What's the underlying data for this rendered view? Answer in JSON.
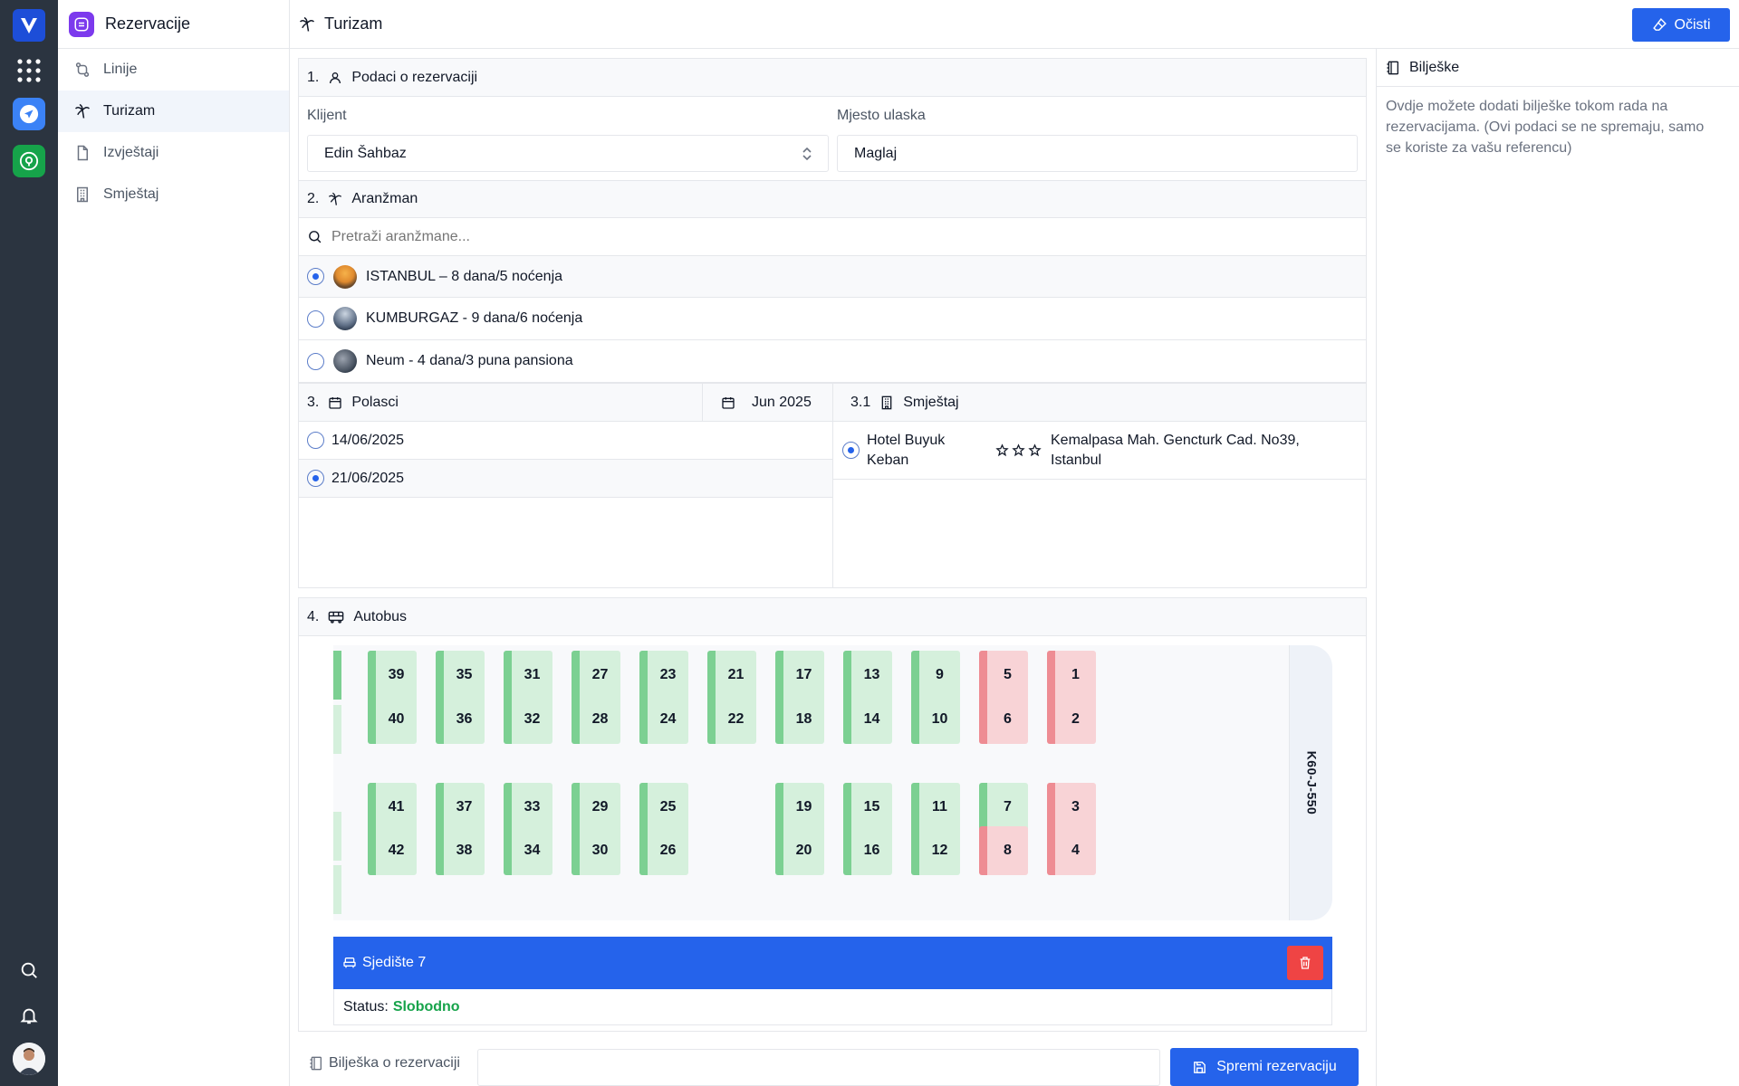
{
  "app": {
    "title": "Rezervacije",
    "page_title": "Turizam",
    "clear_label": "Očisti"
  },
  "sidebar": {
    "items": [
      {
        "label": "Linije",
        "icon": "route-icon"
      },
      {
        "label": "Turizam",
        "icon": "palm-tree-icon",
        "active": true
      },
      {
        "label": "Izvještaji",
        "icon": "document-icon"
      },
      {
        "label": "Smještaj",
        "icon": "building-icon"
      }
    ]
  },
  "reservation": {
    "num": "1.",
    "title": "Podaci o rezervaciji",
    "client_label": "Klijent",
    "client_value": "Edin Šahbaz",
    "boarding_label": "Mjesto ulaska",
    "boarding_value": "Maglaj"
  },
  "arrangement": {
    "num": "2.",
    "title": "Aranžman",
    "search_placeholder": "Pretraži aranžmane...",
    "items": [
      {
        "label": "ISTANBUL – 8 dana/5 noćenja",
        "selected": true
      },
      {
        "label": "KUMBURGAZ - 9 dana/6 noćenja",
        "selected": false
      },
      {
        "label": "Neum - 4 dana/3 puna pansiona",
        "selected": false
      }
    ]
  },
  "departures": {
    "num": "3.",
    "title": "Polasci",
    "month": "Jun 2025",
    "items": [
      {
        "date": "14/06/2025",
        "selected": false
      },
      {
        "date": "21/06/2025",
        "selected": true
      }
    ]
  },
  "accommodation": {
    "num": "3.1",
    "title": "Smještaj",
    "hotel_line1": "Hotel Buyuk",
    "hotel_line2": "Keban",
    "address_line1": "Kemalpasa Mah. Gencturk Cad. No39,",
    "address_line2": "Istanbul",
    "stars": 3
  },
  "bus": {
    "num": "4.",
    "title": "Autobus",
    "plate": "K60-J-550",
    "selected_seat_label": "Sjedište 7",
    "status_label": "Status:",
    "status_value": "Slobodno",
    "colors": {
      "free": "#d5f0dc",
      "free_accent": "#7cd092",
      "taken": "#f8d3d6",
      "taken_accent": "#ee8c93",
      "selected_bar": "#2563eb",
      "status_ok": "#16a34a"
    },
    "seats": [
      {
        "n": "39",
        "s": "free"
      },
      {
        "n": "35",
        "s": "free"
      },
      {
        "n": "31",
        "s": "free"
      },
      {
        "n": "27",
        "s": "free"
      },
      {
        "n": "23",
        "s": "free"
      },
      {
        "n": "21",
        "s": "free"
      },
      {
        "n": "17",
        "s": "free"
      },
      {
        "n": "13",
        "s": "free"
      },
      {
        "n": "9",
        "s": "free"
      },
      {
        "n": "5",
        "s": "taken"
      },
      {
        "n": "1",
        "s": "taken"
      },
      {
        "n": "40",
        "s": "free"
      },
      {
        "n": "36",
        "s": "free"
      },
      {
        "n": "32",
        "s": "free"
      },
      {
        "n": "28",
        "s": "free"
      },
      {
        "n": "24",
        "s": "free"
      },
      {
        "n": "22",
        "s": "free"
      },
      {
        "n": "18",
        "s": "free"
      },
      {
        "n": "14",
        "s": "free"
      },
      {
        "n": "10",
        "s": "free"
      },
      {
        "n": "6",
        "s": "taken"
      },
      {
        "n": "2",
        "s": "taken"
      },
      {
        "n": "41",
        "s": "free"
      },
      {
        "n": "37",
        "s": "free"
      },
      {
        "n": "33",
        "s": "free"
      },
      {
        "n": "29",
        "s": "free"
      },
      {
        "n": "25",
        "s": "free"
      },
      {
        "n": "19",
        "s": "free"
      },
      {
        "n": "15",
        "s": "free"
      },
      {
        "n": "11",
        "s": "free"
      },
      {
        "n": "7",
        "s": "free"
      },
      {
        "n": "3",
        "s": "taken"
      },
      {
        "n": "42",
        "s": "free"
      },
      {
        "n": "38",
        "s": "free"
      },
      {
        "n": "34",
        "s": "free"
      },
      {
        "n": "30",
        "s": "free"
      },
      {
        "n": "26",
        "s": "free"
      },
      {
        "n": "20",
        "s": "free"
      },
      {
        "n": "16",
        "s": "free"
      },
      {
        "n": "12",
        "s": "free"
      },
      {
        "n": "8",
        "s": "taken"
      },
      {
        "n": "4",
        "s": "taken"
      }
    ]
  },
  "footer": {
    "note_label": "Bilješka o rezervaciji",
    "note_value": "",
    "save_label": "Spremi rezervaciju"
  },
  "notes": {
    "title": "Bilješke",
    "text": "Ovdje možete dodati bilješke tokom rada na rezervacijama. (Ovi podaci se ne spremaju, samo se koriste za vašu referencu)"
  }
}
